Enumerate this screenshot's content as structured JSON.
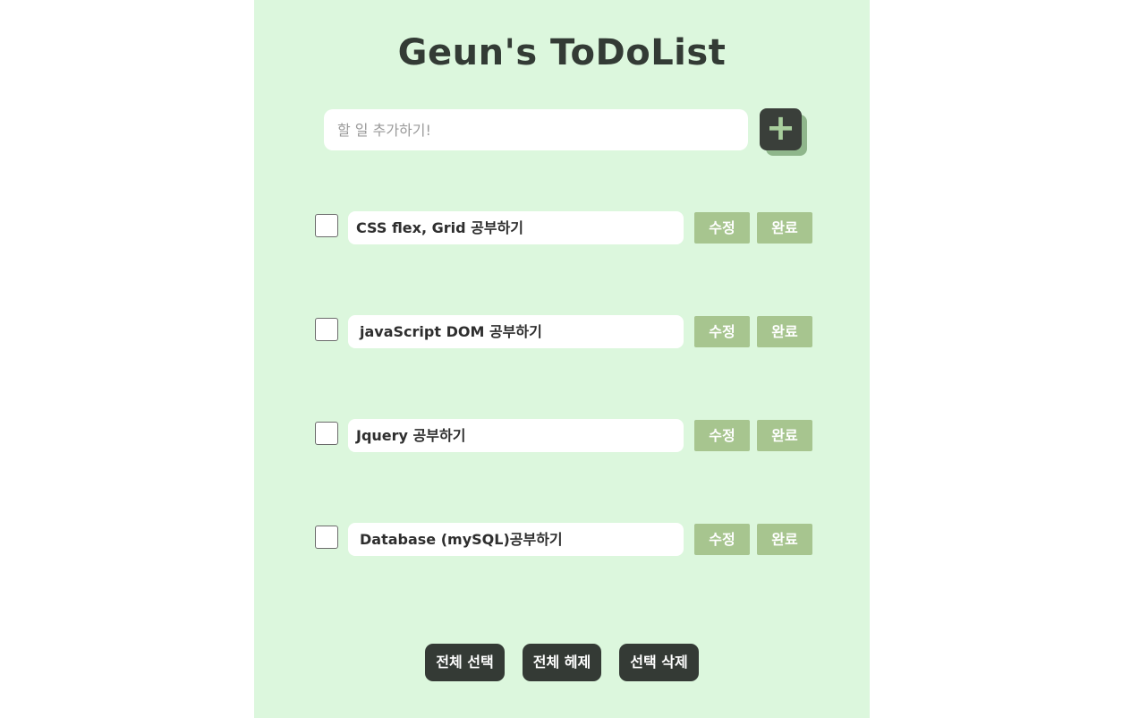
{
  "app": {
    "title": "Geun's ToDoList"
  },
  "add_form": {
    "placeholder": "할 일 추가하기!",
    "value": "",
    "add_button_label": "+"
  },
  "todos": [
    {
      "text": "CSS flex, Grid 공부하기",
      "checked": false,
      "edit_label": "수정",
      "done_label": "완료"
    },
    {
      "text": "javaScript DOM 공부하기",
      "checked": false,
      "edit_label": "수정",
      "done_label": "완료"
    },
    {
      "text": "Jquery 공부하기",
      "checked": false,
      "edit_label": "수정",
      "done_label": "완료"
    },
    {
      "text": "Database (mySQL)공부하기",
      "checked": false,
      "edit_label": "수정",
      "done_label": "완료"
    }
  ],
  "footer": {
    "select_all_label": "전체 선택",
    "deselect_all_label": "전체 헤제",
    "delete_selected_label": "선택 삭제"
  },
  "colors": {
    "page_background": "#ffffff",
    "panel_background": "#dcf7dd",
    "dark_button": "#343a35",
    "green_button": "#a7c58f",
    "add_button_shadow": "#8fb68b"
  }
}
